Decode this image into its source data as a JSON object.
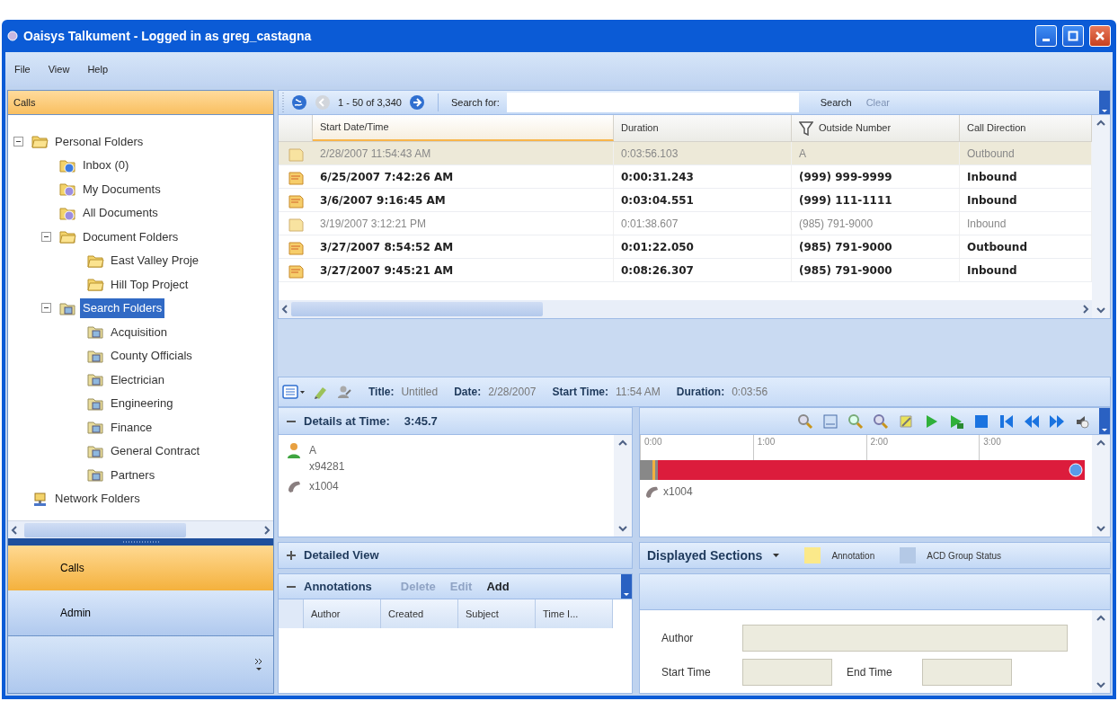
{
  "window": {
    "title": "Oaisys Talkument - Logged in as greg_castagna"
  },
  "menu": [
    "File",
    "View",
    "Help"
  ],
  "nav_pane": {
    "header": "Calls",
    "tree": [
      {
        "label": "Personal Folders",
        "kind": "folder",
        "expanded": true,
        "selected": false,
        "children": [
          {
            "label": "Inbox (0)",
            "kind": "inbox",
            "selected": false
          },
          {
            "label": "My Documents",
            "kind": "documents",
            "selected": false
          },
          {
            "label": "All Documents",
            "kind": "documents",
            "selected": false
          },
          {
            "label": "Document Folders",
            "kind": "folder",
            "expanded": true,
            "selected": false,
            "children": [
              {
                "label": "East Valley Proje",
                "kind": "folder",
                "selected": false
              },
              {
                "label": "Hill Top Project",
                "kind": "folder",
                "selected": false
              }
            ]
          },
          {
            "label": "Search Folders",
            "kind": "search",
            "expanded": true,
            "selected": true,
            "children": [
              {
                "label": "Acquisition",
                "kind": "search",
                "selected": false
              },
              {
                "label": "County Officials",
                "kind": "search",
                "selected": false
              },
              {
                "label": "Electrician",
                "kind": "search",
                "selected": false
              },
              {
                "label": "Engineering",
                "kind": "search",
                "selected": false
              },
              {
                "label": "Finance",
                "kind": "search",
                "selected": false
              },
              {
                "label": "General Contract",
                "kind": "search",
                "selected": false
              },
              {
                "label": "Partners",
                "kind": "search",
                "selected": false
              }
            ]
          }
        ]
      },
      {
        "label": "Network Folders",
        "kind": "network",
        "selected": false
      }
    ],
    "buttons": [
      {
        "label": "Calls",
        "selected": true
      },
      {
        "label": "Admin",
        "selected": false
      }
    ]
  },
  "toolbar": {
    "range": "1 - 50 of 3,340",
    "search_label": "Search for:",
    "search_button": "Search",
    "clear_button": {
      "label": "Clear",
      "disabled": true
    }
  },
  "calls_table": {
    "columns": [
      {
        "label": "Start Date/Time",
        "active": true,
        "filtered": false
      },
      {
        "label": "Duration",
        "active": false,
        "filtered": false
      },
      {
        "label": "Outside Number",
        "active": false,
        "filtered": true
      },
      {
        "label": "Call Direction",
        "active": false,
        "filtered": false
      }
    ],
    "rows": [
      {
        "cells": [
          "2/28/2007 11:54:43 AM",
          "0:03:56.103",
          "A",
          "Outbound"
        ],
        "unread": false,
        "selected": true
      },
      {
        "cells": [
          "6/25/2007 7:42:26 AM",
          "0:00:31.243",
          "(999) 999-9999",
          "Inbound"
        ],
        "unread": true,
        "selected": false
      },
      {
        "cells": [
          "3/6/2007 9:16:45 AM",
          "0:03:04.551",
          "(999) 111-1111",
          "Inbound"
        ],
        "unread": true,
        "selected": false
      },
      {
        "cells": [
          "3/19/2007 3:12:21 PM",
          "0:01:38.607",
          "(985) 791-9000",
          "Inbound"
        ],
        "unread": false,
        "selected": false
      },
      {
        "cells": [
          "3/27/2007 8:54:52 AM",
          "0:01:22.050",
          "(985) 791-9000",
          "Outbound"
        ],
        "unread": true,
        "selected": false
      },
      {
        "cells": [
          "3/27/2007 9:45:21 AM",
          "0:08:26.307",
          "(985) 791-9000",
          "Inbound"
        ],
        "unread": true,
        "selected": false
      }
    ]
  },
  "call_info": [
    {
      "label": "Title:",
      "value": "Untitled"
    },
    {
      "label": "Date:",
      "value": "2/28/2007"
    },
    {
      "label": "Start Time:",
      "value": "11:54 AM"
    },
    {
      "label": "Duration:",
      "value": "0:03:56"
    }
  ],
  "details": {
    "header": "Details at Time:",
    "time": "3:45.7",
    "expanded": true,
    "entries": [
      {
        "kind": "person",
        "lines": [
          "A",
          "x94281"
        ]
      },
      {
        "kind": "phone",
        "lines": [
          "x1004"
        ]
      }
    ]
  },
  "timeline": {
    "ticks": [
      "0:00",
      "1:00",
      "2:00",
      "3:00"
    ],
    "tracks": [
      {
        "kind": "phone",
        "label": "x1004"
      }
    ]
  },
  "detailed_view": {
    "header": "Detailed View",
    "expanded": false
  },
  "displayed_sections": {
    "label": "Displayed Sections",
    "legend": [
      {
        "label": "Annotation",
        "color": "#fbe98a"
      },
      {
        "label": "ACD Group Status",
        "color": "#b4c9e6"
      }
    ]
  },
  "annotations": {
    "header": "Annotations",
    "expanded": true,
    "actions": [
      {
        "label": "Delete",
        "disabled": true
      },
      {
        "label": "Edit",
        "disabled": true
      },
      {
        "label": "Add",
        "disabled": false
      }
    ],
    "columns": [
      "Author",
      "Created",
      "Subject",
      "Time I..."
    ]
  },
  "annotation_form": {
    "fields": [
      {
        "label": "Author",
        "kind": "wide"
      },
      {
        "label": "Start Time",
        "kind": "short"
      },
      {
        "label": "End Time",
        "kind": "short"
      }
    ]
  }
}
